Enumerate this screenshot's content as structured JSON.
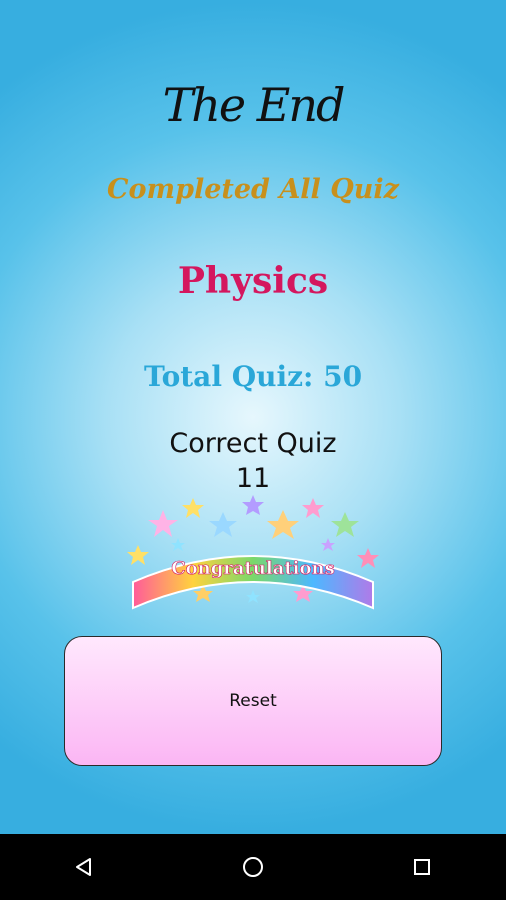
{
  "screen": {
    "title_graphic": "The End",
    "completed_text": "Completed All Quiz",
    "subject": "Physics",
    "total_quiz": "Total Quiz: 50",
    "correct_label": "Correct Quiz",
    "correct_value": "11",
    "congrats_banner": "Congratulations",
    "reset_label": "Reset"
  },
  "colors": {
    "completed": "#c8901c",
    "subject": "#d4175e",
    "total": "#2aa7d8",
    "background": "#37aee0"
  },
  "navbar": {
    "back_icon": "back-triangle-icon",
    "home_icon": "home-circle-icon",
    "recents_icon": "recents-square-icon"
  }
}
